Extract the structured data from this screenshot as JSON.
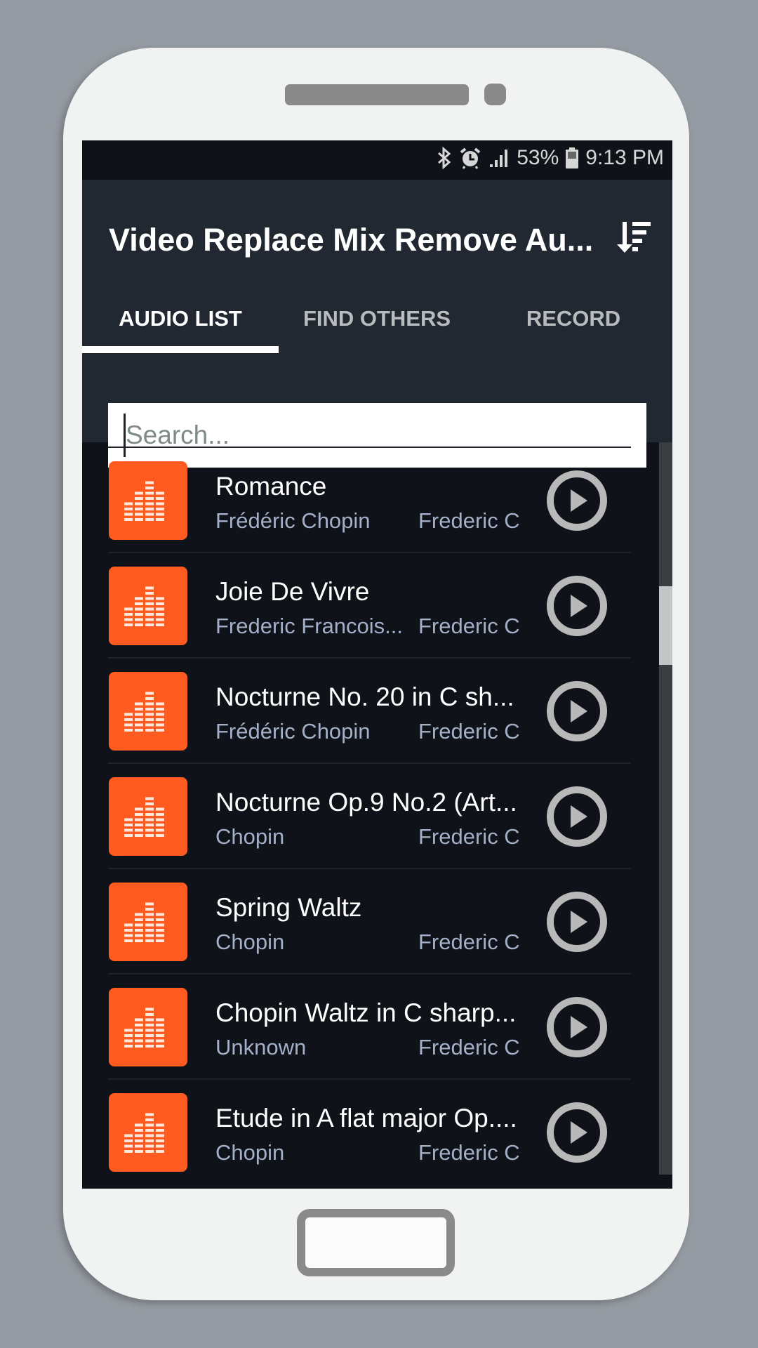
{
  "status_bar": {
    "icons": [
      "bluetooth-icon",
      "alarm-icon",
      "signal-icon",
      "battery-icon"
    ],
    "battery": "53%",
    "time": "9:13 PM"
  },
  "app_bar": {
    "title": "Video Replace Mix Remove Au...",
    "sort_icon": "sort-icon"
  },
  "tabs": [
    {
      "label": "AUDIO LIST",
      "active": true
    },
    {
      "label": "FIND OTHERS",
      "active": false
    },
    {
      "label": "RECORD",
      "active": false
    }
  ],
  "search": {
    "placeholder": "Search...",
    "value": ""
  },
  "colors": {
    "accent": "#ff5a1f",
    "app_bar": "#222832",
    "list_bg": "#0f1218",
    "subtitle": "#a3b0c8"
  },
  "songs": [
    {
      "title": "Romance",
      "artist": "Frédéric Chopin",
      "album": "Frederic C"
    },
    {
      "title": "Joie De Vivre",
      "artist": "Frederic Francois...",
      "album": "Frederic C"
    },
    {
      "title": "Nocturne No. 20 in C sh...",
      "artist": "Frédéric Chopin",
      "album": "Frederic C"
    },
    {
      "title": "Nocturne Op.9 No.2 (Art...",
      "artist": "Chopin",
      "album": "Frederic C"
    },
    {
      "title": "Spring Waltz",
      "artist": "Chopin",
      "album": "Frederic C"
    },
    {
      "title": "Chopin Waltz in C sharp...",
      "artist": "Unknown",
      "album": "Frederic C"
    },
    {
      "title": "Etude in A flat major Op....",
      "artist": "Chopin",
      "album": "Frederic C"
    }
  ],
  "scroll_position": 0.22
}
